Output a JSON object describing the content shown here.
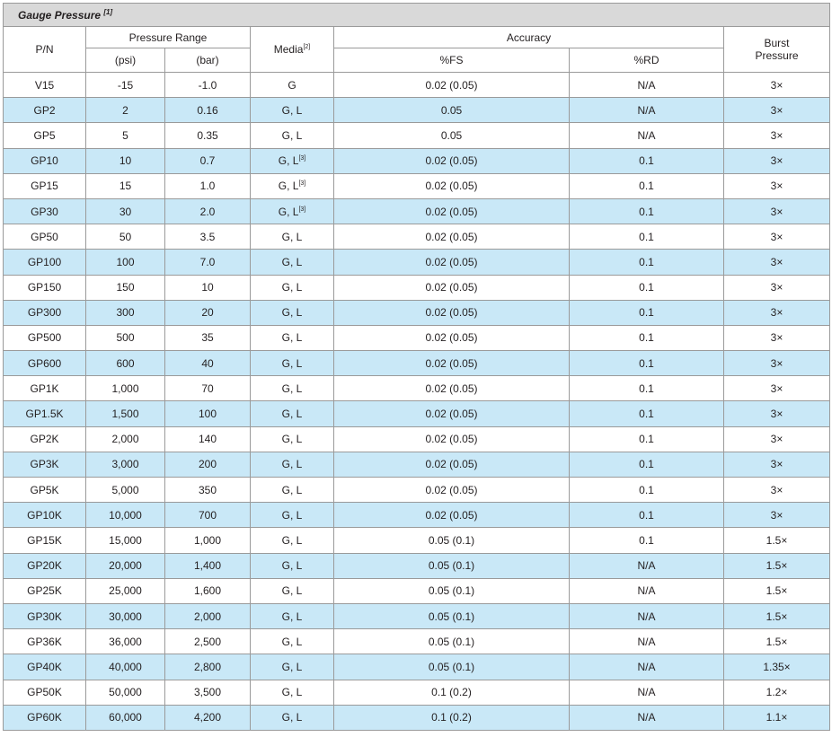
{
  "title": "Gauge Pressure",
  "title_ref": "[1]",
  "headers": {
    "pn": "P/N",
    "pressure_range": "Pressure Range",
    "psi": "(psi)",
    "bar": "(bar)",
    "media": "Media",
    "media_ref": "[2]",
    "accuracy": "Accuracy",
    "fs": "%FS",
    "rd": "%RD",
    "burst_line1": "Burst",
    "burst_line2": "Pressure"
  },
  "rows": [
    {
      "pn": "V15",
      "psi": "-15",
      "bar": "-1.0",
      "media": "G",
      "media_ref": "",
      "fs": "0.02 (0.05)",
      "rd": "N/A",
      "burst": "3×"
    },
    {
      "pn": "GP2",
      "psi": "2",
      "bar": "0.16",
      "media": "G, L",
      "media_ref": "",
      "fs": "0.05",
      "rd": "N/A",
      "burst": "3×"
    },
    {
      "pn": "GP5",
      "psi": "5",
      "bar": "0.35",
      "media": "G, L",
      "media_ref": "",
      "fs": "0.05",
      "rd": "N/A",
      "burst": "3×"
    },
    {
      "pn": "GP10",
      "psi": "10",
      "bar": "0.7",
      "media": "G, L",
      "media_ref": "[3]",
      "fs": "0.02 (0.05)",
      "rd": "0.1",
      "burst": "3×"
    },
    {
      "pn": "GP15",
      "psi": "15",
      "bar": "1.0",
      "media": "G, L",
      "media_ref": "[3]",
      "fs": "0.02 (0.05)",
      "rd": "0.1",
      "burst": "3×"
    },
    {
      "pn": "GP30",
      "psi": "30",
      "bar": "2.0",
      "media": "G, L",
      "media_ref": "[3]",
      "fs": "0.02 (0.05)",
      "rd": "0.1",
      "burst": "3×"
    },
    {
      "pn": "GP50",
      "psi": "50",
      "bar": "3.5",
      "media": "G, L",
      "media_ref": "",
      "fs": "0.02 (0.05)",
      "rd": "0.1",
      "burst": "3×"
    },
    {
      "pn": "GP100",
      "psi": "100",
      "bar": "7.0",
      "media": "G, L",
      "media_ref": "",
      "fs": "0.02 (0.05)",
      "rd": "0.1",
      "burst": "3×"
    },
    {
      "pn": "GP150",
      "psi": "150",
      "bar": "10",
      "media": "G, L",
      "media_ref": "",
      "fs": "0.02 (0.05)",
      "rd": "0.1",
      "burst": "3×"
    },
    {
      "pn": "GP300",
      "psi": "300",
      "bar": "20",
      "media": "G, L",
      "media_ref": "",
      "fs": "0.02 (0.05)",
      "rd": "0.1",
      "burst": "3×"
    },
    {
      "pn": "GP500",
      "psi": "500",
      "bar": "35",
      "media": "G, L",
      "media_ref": "",
      "fs": "0.02 (0.05)",
      "rd": "0.1",
      "burst": "3×"
    },
    {
      "pn": "GP600",
      "psi": "600",
      "bar": "40",
      "media": "G, L",
      "media_ref": "",
      "fs": "0.02 (0.05)",
      "rd": "0.1",
      "burst": "3×"
    },
    {
      "pn": "GP1K",
      "psi": "1,000",
      "bar": "70",
      "media": "G, L",
      "media_ref": "",
      "fs": "0.02 (0.05)",
      "rd": "0.1",
      "burst": "3×"
    },
    {
      "pn": "GP1.5K",
      "psi": "1,500",
      "bar": "100",
      "media": "G, L",
      "media_ref": "",
      "fs": "0.02 (0.05)",
      "rd": "0.1",
      "burst": "3×"
    },
    {
      "pn": "GP2K",
      "psi": "2,000",
      "bar": "140",
      "media": "G, L",
      "media_ref": "",
      "fs": "0.02 (0.05)",
      "rd": "0.1",
      "burst": "3×"
    },
    {
      "pn": "GP3K",
      "psi": "3,000",
      "bar": "200",
      "media": "G, L",
      "media_ref": "",
      "fs": "0.02 (0.05)",
      "rd": "0.1",
      "burst": "3×"
    },
    {
      "pn": "GP5K",
      "psi": "5,000",
      "bar": "350",
      "media": "G, L",
      "media_ref": "",
      "fs": "0.02 (0.05)",
      "rd": "0.1",
      "burst": "3×"
    },
    {
      "pn": "GP10K",
      "psi": "10,000",
      "bar": "700",
      "media": "G, L",
      "media_ref": "",
      "fs": "0.02 (0.05)",
      "rd": "0.1",
      "burst": "3×"
    },
    {
      "pn": "GP15K",
      "psi": "15,000",
      "bar": "1,000",
      "media": "G, L",
      "media_ref": "",
      "fs": "0.05 (0.1)",
      "rd": "0.1",
      "burst": "1.5×"
    },
    {
      "pn": "GP20K",
      "psi": "20,000",
      "bar": "1,400",
      "media": "G, L",
      "media_ref": "",
      "fs": "0.05 (0.1)",
      "rd": "N/A",
      "burst": "1.5×"
    },
    {
      "pn": "GP25K",
      "psi": "25,000",
      "bar": "1,600",
      "media": "G, L",
      "media_ref": "",
      "fs": "0.05 (0.1)",
      "rd": "N/A",
      "burst": "1.5×"
    },
    {
      "pn": "GP30K",
      "psi": "30,000",
      "bar": "2,000",
      "media": "G, L",
      "media_ref": "",
      "fs": "0.05 (0.1)",
      "rd": "N/A",
      "burst": "1.5×"
    },
    {
      "pn": "GP36K",
      "psi": "36,000",
      "bar": "2,500",
      "media": "G, L",
      "media_ref": "",
      "fs": "0.05 (0.1)",
      "rd": "N/A",
      "burst": "1.5×"
    },
    {
      "pn": "GP40K",
      "psi": "40,000",
      "bar": "2,800",
      "media": "G, L",
      "media_ref": "",
      "fs": "0.05 (0.1)",
      "rd": "N/A",
      "burst": "1.35×"
    },
    {
      "pn": "GP50K",
      "psi": "50,000",
      "bar": "3,500",
      "media": "G, L",
      "media_ref": "",
      "fs": "0.1 (0.2)",
      "rd": "N/A",
      "burst": "1.2×"
    },
    {
      "pn": "GP60K",
      "psi": "60,000",
      "bar": "4,200",
      "media": "G, L",
      "media_ref": "",
      "fs": "0.1 (0.2)",
      "rd": "N/A",
      "burst": "1.1×"
    }
  ]
}
